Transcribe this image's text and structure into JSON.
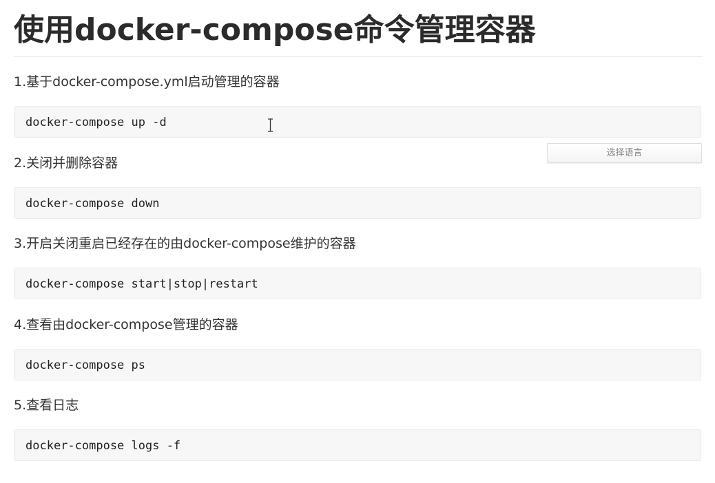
{
  "article": {
    "title": "使用docker-compose命令管理容器",
    "steps": [
      {
        "text": "1.基于docker-compose.yml启动管理的容器",
        "code": "docker-compose up -d"
      },
      {
        "text": "2.关闭并删除容器",
        "code": "docker-compose down"
      },
      {
        "text": "3.开启关闭重启已经存在的由docker-compose维护的容器",
        "code": "docker-compose start|stop|restart"
      },
      {
        "text": "4.查看由docker-compose管理的容器",
        "code": "docker-compose ps"
      },
      {
        "text": "5.查看日志",
        "code": "docker-compose logs -f"
      }
    ]
  },
  "language_selector": {
    "label": "选择语言"
  },
  "icons": {
    "cursor": "text-cursor-icon"
  }
}
